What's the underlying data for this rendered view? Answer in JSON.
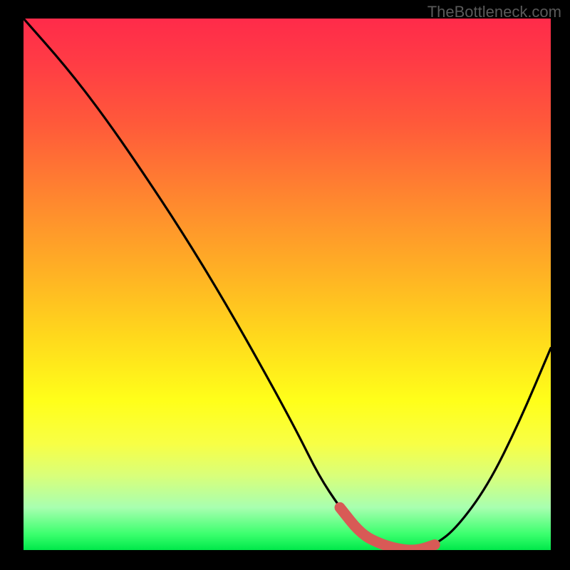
{
  "watermark": "TheBottleneck.com",
  "chart_data": {
    "type": "line",
    "title": "",
    "xlabel": "",
    "ylabel": "",
    "xlim": [
      0,
      100
    ],
    "ylim": [
      0,
      100
    ],
    "series": [
      {
        "name": "curve",
        "x": [
          0,
          8,
          15,
          22,
          30,
          38,
          46,
          52,
          56,
          60,
          64,
          68,
          72,
          75,
          78,
          82,
          88,
          94,
          100
        ],
        "values": [
          100,
          91,
          82,
          72,
          60,
          47,
          33,
          22,
          14,
          8,
          3,
          1,
          0,
          0,
          1,
          4,
          12,
          24,
          38
        ]
      }
    ],
    "highlight_segment": {
      "x_start": 59,
      "x_end": 77
    }
  }
}
